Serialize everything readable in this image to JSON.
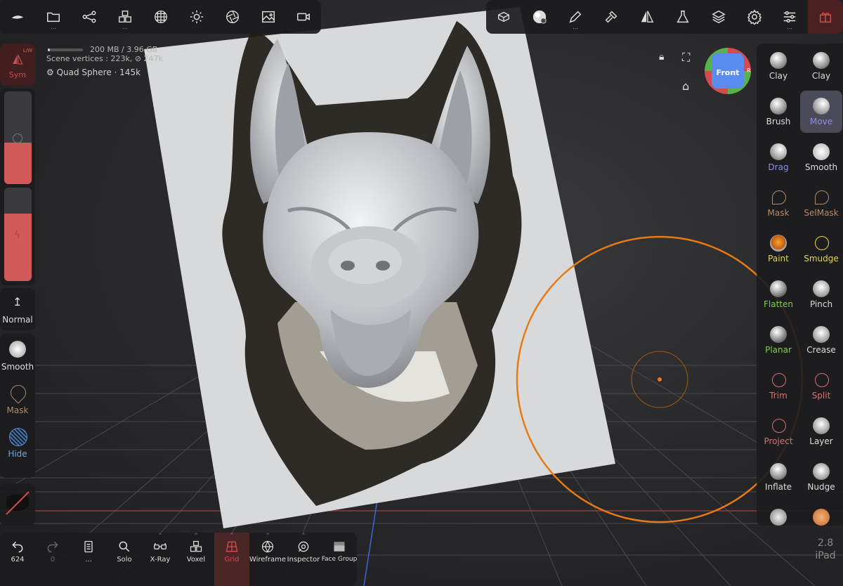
{
  "colors": {
    "accent_orange": "#e87a14",
    "active_red": "#d24c4c",
    "move_blue": "#8b8ff0",
    "mask_brown": "#b08a6a",
    "green_label": "#7bd14a",
    "yellow_label": "#e6d44a",
    "trim_red": "#d97070",
    "grid_red": "#e05050"
  },
  "top_left_toolbar": {
    "icons": [
      "logo-icon",
      "folder-icon",
      "scene-graph-icon",
      "voxel-cubes-icon",
      "sphere-grid-icon",
      "sun-icon",
      "aperture-icon",
      "image-icon",
      "video-icon"
    ]
  },
  "top_right_toolbar": {
    "icons": [
      "snapshot-icon",
      "material-ball-icon",
      "pencil-icon",
      "hammer-icon",
      "symmetry-icon",
      "flask-icon",
      "layers-icon",
      "gear-icon",
      "sliders-icon",
      "gift-icon"
    ]
  },
  "hud": {
    "memory": "200 MB / 3.96 GB",
    "scene_vertices_label": "Scene vertices :",
    "scene_vertices": "223k",
    "link_count": "247k",
    "object_name": "Quad Sphere",
    "object_count": "145k",
    "memory_fraction": 0.05
  },
  "left_panel": {
    "sym_label": "Sym",
    "lw_label": "L/W",
    "radius_fraction": 0.45,
    "intensity_fraction": 0.72,
    "normal_label": "Normal",
    "smooth_label": "Smooth",
    "mask_label": "Mask",
    "hide_label": "Hide"
  },
  "viewcube": {
    "label": "Front",
    "left_letter": "",
    "right_letter": "R"
  },
  "tools": [
    {
      "name": "Clay",
      "color": "#dddddd"
    },
    {
      "name": "Clay",
      "color": "#dddddd"
    },
    {
      "name": "Brush",
      "color": "#dddddd"
    },
    {
      "name": "Move",
      "color": "#8b8ff0",
      "active": true
    },
    {
      "name": "Drag",
      "color": "#8b8ff0"
    },
    {
      "name": "Smooth",
      "color": "#dddddd"
    },
    {
      "name": "Mask",
      "color": "#b08a6a"
    },
    {
      "name": "SelMask",
      "color": "#b08a6a"
    },
    {
      "name": "Paint",
      "color": "#e6d44a"
    },
    {
      "name": "Smudge",
      "color": "#e6d44a"
    },
    {
      "name": "Flatten",
      "color": "#7bd14a"
    },
    {
      "name": "Pinch",
      "color": "#dddddd"
    },
    {
      "name": "Planar",
      "color": "#7bd14a"
    },
    {
      "name": "Crease",
      "color": "#dddddd"
    },
    {
      "name": "Trim",
      "color": "#d97070"
    },
    {
      "name": "Split",
      "color": "#d97070"
    },
    {
      "name": "Project",
      "color": "#d97070"
    },
    {
      "name": "Layer",
      "color": "#dddddd"
    },
    {
      "name": "Inflate",
      "color": "#dddddd"
    },
    {
      "name": "Nudge",
      "color": "#dddddd"
    }
  ],
  "bottom_bar": {
    "undo_count": "624",
    "redo_count": "0",
    "more_label": "...",
    "items": [
      "Solo",
      "X-Ray",
      "Voxel",
      "Grid",
      "Wireframe",
      "Inspector",
      "Face Group"
    ]
  },
  "watermark": {
    "version": "2.8",
    "device": "iPad"
  }
}
